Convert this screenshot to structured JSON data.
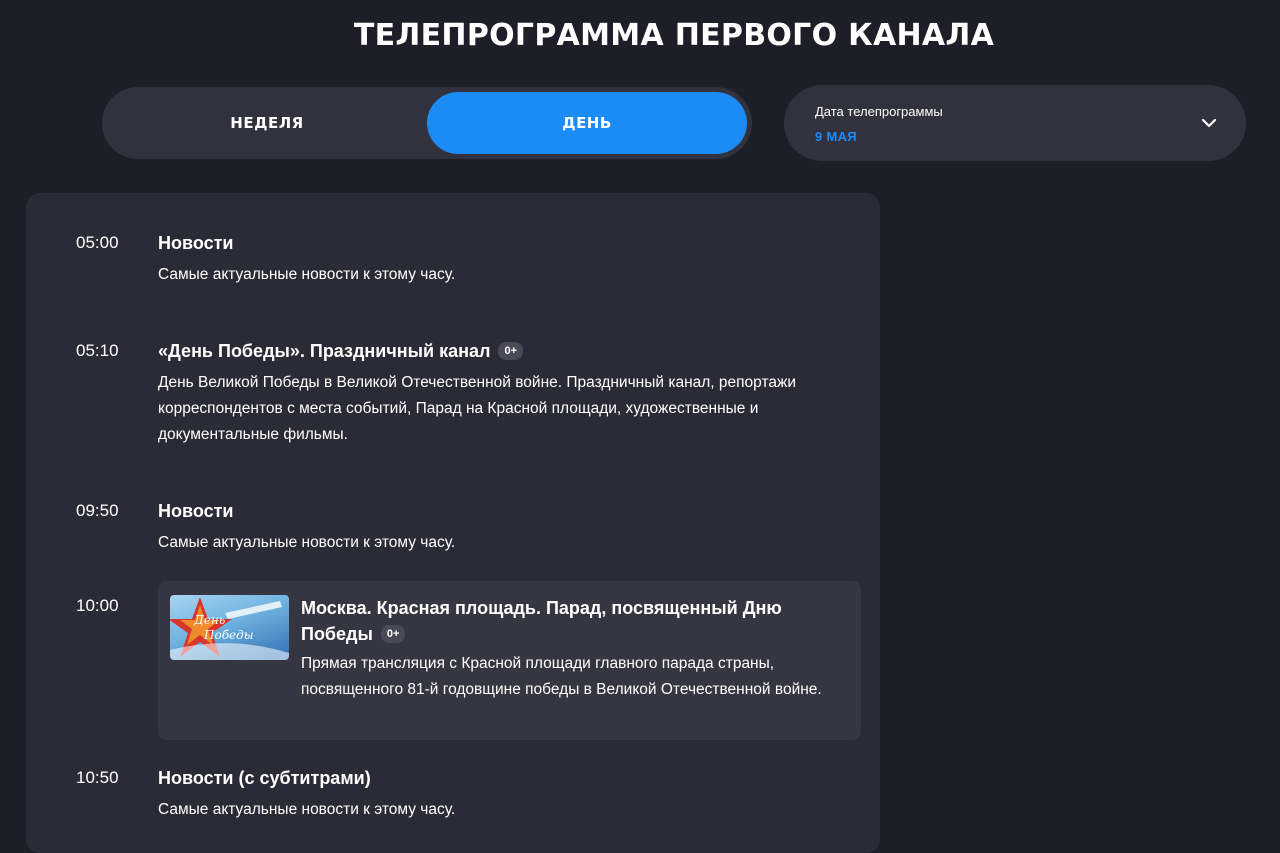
{
  "page_title": "ТЕЛЕПРОГРАММА ПЕРВОГО КАНАЛА",
  "view_toggle": {
    "week_label": "НЕДЕЛЯ",
    "day_label": "ДЕНЬ",
    "active": "day"
  },
  "date_select": {
    "label": "Дата телепрограммы",
    "value": "9 МАЯ"
  },
  "schedule": [
    {
      "time": "05:00",
      "title": "Новости",
      "description": "Самые актуальные новости к этому часу."
    },
    {
      "time": "05:10",
      "title": "«День Победы». Праздничный канал",
      "badge": "0+",
      "description": "День Великой Победы в Великой Отечественной войне. Праздничный канал, репортажи корреспондентов с места событий, Парад на Красной площади, художественные и документальные фильмы."
    },
    {
      "time": "09:50",
      "title": "Новости",
      "description": "Самые актуальные новости к этому часу."
    },
    {
      "time": "10:00",
      "title": "Москва. Красная площадь. Парад, посвященный Дню Победы",
      "badge": "0+",
      "thumbnail_text": "День Победы",
      "description": "Прямая трансляция с Красной площади главного парада страны, посвященного 81-й годовщине победы в Великой Отечественной войне."
    },
    {
      "time": "10:50",
      "title": "Новости (с субтитрами)",
      "description": "Самые актуальные новости к этому часу."
    }
  ],
  "colors": {
    "background": "#1e1e28",
    "panel": "#2b2b37",
    "accent": "#1b8bf5"
  }
}
